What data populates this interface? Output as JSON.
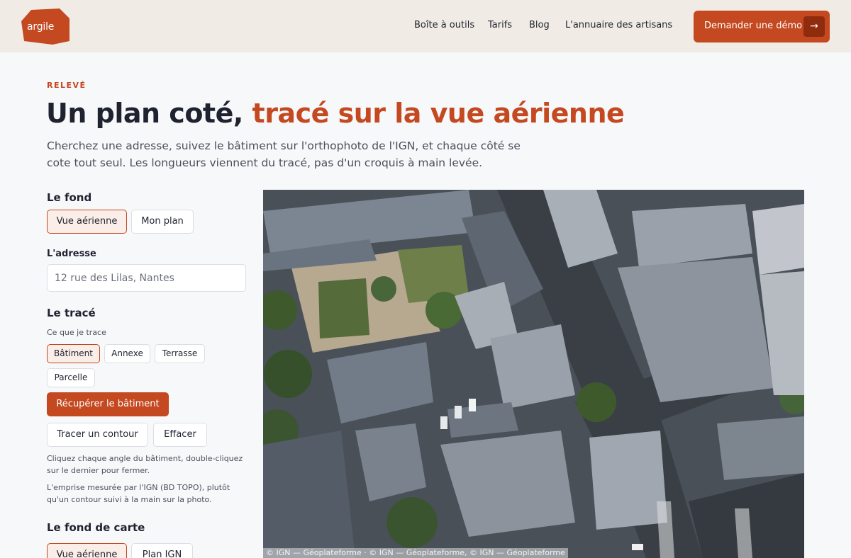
{
  "header": {
    "logo_text": "argile",
    "nav": [
      "Boîte à outils",
      "Tarifs",
      "Blog",
      "L'annuaire des artisans"
    ],
    "cta_label": "Demander une démo",
    "cta_icon": "arrow-right-icon"
  },
  "hero": {
    "eyebrow": "RELEVÉ",
    "title_plain": "Un plan coté,",
    "title_accent": "tracé sur la vue aérienne",
    "lead": "Cherchez une adresse, suivez le bâtiment sur l'orthophoto de l'IGN, et chaque côté se cote tout seul. Les longueurs viennent du tracé, pas d'un croquis à main levée."
  },
  "panel": {
    "fond_title": "Le fond",
    "fond_options": [
      "Vue aérienne",
      "Mon plan"
    ],
    "fond_selected": "Vue aérienne",
    "address_label": "L'adresse",
    "address_placeholder": "12 rue des Lilas, Nantes",
    "trace_title": "Le tracé",
    "trace_sub": "Ce que je trace",
    "trace_options": [
      "Bâtiment",
      "Annexe",
      "Terrasse",
      "Parcelle"
    ],
    "trace_selected": "Bâtiment",
    "fetch_button": "Récupérer le bâtiment",
    "draw_button": "Tracer un contour",
    "clear_button": "Effacer",
    "help_1": "Cliquez chaque angle du bâtiment, double-cliquez sur le dernier pour fermer.",
    "help_2": "L'emprise mesurée par l'IGN (BD TOPO), plutôt qu'un contour suivi à la main sur la photo.",
    "basemap_title": "Le fond de carte",
    "basemap_options": [
      "Vue aérienne",
      "Plan IGN"
    ],
    "basemap_selected": "Vue aérienne"
  },
  "map": {
    "attribution": "© IGN — Géoplateforme · © IGN — Géoplateforme, © IGN — Géoplateforme"
  },
  "colors": {
    "accent": "#c44820",
    "accent_dark": "#8f2c0e",
    "header_bg": "#f1ebe5",
    "page_bg": "#f7f8fa"
  }
}
